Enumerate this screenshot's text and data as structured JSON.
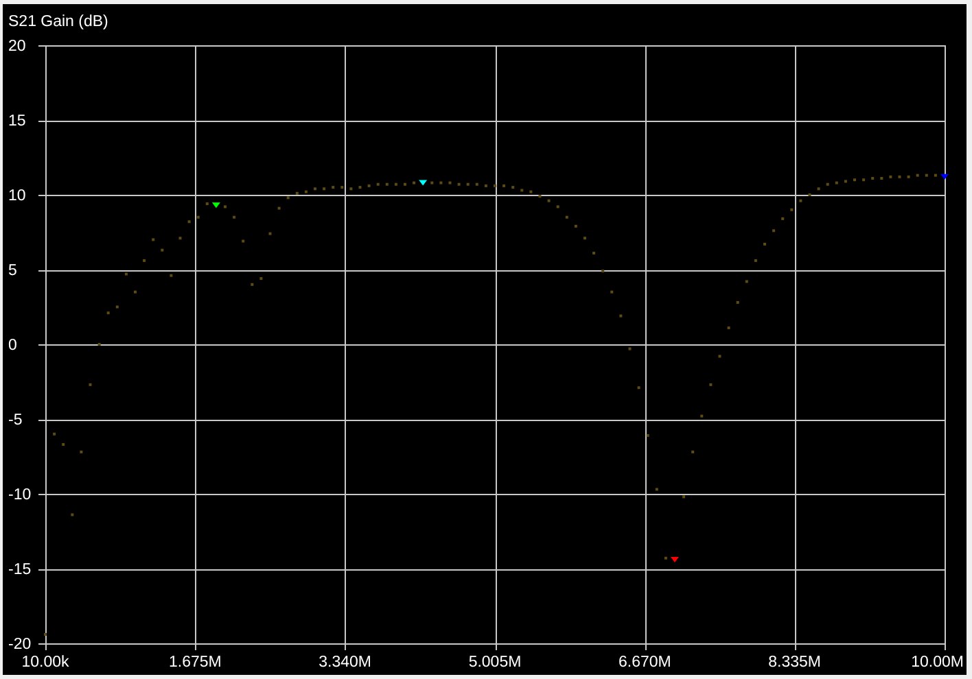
{
  "chart_data": {
    "type": "scatter",
    "title": "S21 Gain (dB)",
    "xlim": [
      10000,
      10000000
    ],
    "ylim": [
      -20,
      20
    ],
    "grid": true,
    "xticks": [
      {
        "value": 10000,
        "label": "10.00k"
      },
      {
        "value": 1675000,
        "label": "1.675M"
      },
      {
        "value": 3340000,
        "label": "3.340M"
      },
      {
        "value": 5005000,
        "label": "5.005M"
      },
      {
        "value": 6670000,
        "label": "6.670M"
      },
      {
        "value": 8335000,
        "label": "8.335M"
      },
      {
        "value": 10000000,
        "label": "10.00M"
      }
    ],
    "yticks": [
      20,
      15,
      10,
      5,
      0,
      -5,
      -10,
      -15,
      -20
    ],
    "x": [
      10000,
      109900,
      209800,
      309700,
      409600,
      509500,
      609400,
      709300,
      809200,
      909100,
      1009000,
      1108900,
      1208800,
      1308700,
      1408600,
      1508500,
      1608400,
      1708300,
      1808200,
      1908100,
      2008000,
      2107900,
      2207800,
      2307700,
      2407600,
      2507500,
      2607400,
      2707300,
      2807200,
      2907100,
      3007000,
      3106900,
      3206800,
      3306700,
      3406600,
      3506500,
      3606400,
      3706300,
      3806200,
      3906100,
      4006000,
      4105900,
      4205800,
      4305700,
      4405600,
      4505500,
      4605400,
      4705300,
      4805200,
      4905100,
      5005000,
      5104900,
      5204800,
      5304700,
      5404600,
      5504500,
      5604400,
      5704300,
      5804200,
      5904100,
      6004000,
      6103900,
      6203800,
      6303700,
      6403600,
      6503500,
      6603400,
      6703300,
      6803200,
      6903100,
      7003000,
      7102900,
      7202800,
      7302700,
      7402600,
      7502500,
      7602400,
      7702300,
      7802200,
      7902100,
      8002000,
      8101900,
      8201800,
      8301700,
      8401600,
      8501500,
      8601400,
      8701300,
      8801200,
      8901100,
      9001000,
      9100900,
      9200800,
      9300700,
      9400600,
      9500500,
      9600400,
      9700300,
      9800200,
      9900100,
      10000000
    ],
    "series": [
      {
        "color": "#5c4b12",
        "values": [
          -19.4,
          -6.0,
          -6.7,
          -11.4,
          -7.2,
          -2.7,
          0.0,
          2.1,
          2.5,
          4.7,
          3.5,
          5.6,
          7.0,
          6.3,
          4.6,
          7.1,
          8.2,
          8.5,
          9.4,
          null,
          9.2,
          8.5,
          6.9,
          4.0,
          4.4,
          7.4,
          9.1,
          9.8,
          10.1,
          10.2,
          10.4,
          10.4,
          10.5,
          10.5,
          10.4,
          10.5,
          10.6,
          10.7,
          10.7,
          10.7,
          10.7,
          10.8,
          null,
          10.8,
          10.8,
          10.8,
          10.7,
          10.7,
          10.7,
          10.6,
          10.6,
          10.6,
          10.5,
          10.3,
          10.2,
          9.9,
          9.6,
          9.2,
          8.5,
          7.9,
          7.1,
          6.1,
          4.9,
          3.5,
          1.9,
          -0.3,
          -2.9,
          -6.1,
          -9.7,
          -14.3,
          null,
          -10.2,
          -7.2,
          -4.8,
          -2.7,
          -0.8,
          1.1,
          2.8,
          4.2,
          5.6,
          6.7,
          7.6,
          8.4,
          9.0,
          9.6,
          10.0,
          10.4,
          10.7,
          10.8,
          10.9,
          11.0,
          11.0,
          11.1,
          11.1,
          11.2,
          11.2,
          11.2,
          11.3,
          11.3,
          11.3,
          null
        ]
      },
      {
        "color": "#00ff00",
        "values": [
          null,
          null,
          null,
          null,
          null,
          null,
          null,
          null,
          null,
          null,
          null,
          null,
          null,
          null,
          null,
          null,
          null,
          null,
          null,
          9.3,
          null,
          null,
          null,
          null,
          null,
          null,
          null,
          null,
          null,
          null,
          null,
          null,
          null,
          null,
          null,
          null,
          null,
          null,
          null,
          null,
          null,
          null,
          null,
          null,
          null,
          null,
          null,
          null,
          null,
          null,
          null,
          null,
          null,
          null,
          null,
          null,
          null,
          null,
          null,
          null,
          null,
          null,
          null,
          null,
          null,
          null,
          null,
          null,
          null,
          null,
          null,
          null,
          null,
          null,
          null,
          null,
          null,
          null,
          null,
          null,
          null,
          null,
          null,
          null,
          null,
          null,
          null,
          null,
          null,
          null,
          null,
          null,
          null,
          null,
          null,
          null,
          null,
          null,
          null,
          null,
          null
        ]
      },
      {
        "color": "#00ffff",
        "values": [
          null,
          null,
          null,
          null,
          null,
          null,
          null,
          null,
          null,
          null,
          null,
          null,
          null,
          null,
          null,
          null,
          null,
          null,
          null,
          null,
          null,
          null,
          null,
          null,
          null,
          null,
          null,
          null,
          null,
          null,
          null,
          null,
          null,
          null,
          null,
          null,
          null,
          null,
          null,
          null,
          null,
          null,
          10.8,
          null,
          null,
          null,
          null,
          null,
          null,
          null,
          null,
          null,
          null,
          null,
          null,
          null,
          null,
          null,
          null,
          null,
          null,
          null,
          null,
          null,
          null,
          null,
          null,
          null,
          null,
          null,
          null,
          null,
          null,
          null,
          null,
          null,
          null,
          null,
          null,
          null,
          null,
          null,
          null,
          null,
          null,
          null,
          null,
          null,
          null,
          null,
          null,
          null,
          null,
          null,
          null,
          null,
          null,
          null,
          null,
          null,
          null
        ]
      },
      {
        "color": "#ff0000",
        "values": [
          null,
          null,
          null,
          null,
          null,
          null,
          null,
          null,
          null,
          null,
          null,
          null,
          null,
          null,
          null,
          null,
          null,
          null,
          null,
          null,
          null,
          null,
          null,
          null,
          null,
          null,
          null,
          null,
          null,
          null,
          null,
          null,
          null,
          null,
          null,
          null,
          null,
          null,
          null,
          null,
          null,
          null,
          null,
          null,
          null,
          null,
          null,
          null,
          null,
          null,
          null,
          null,
          null,
          null,
          null,
          null,
          null,
          null,
          null,
          null,
          null,
          null,
          null,
          null,
          null,
          null,
          null,
          null,
          null,
          null,
          -14.4,
          null,
          null,
          null,
          null,
          null,
          null,
          null,
          null,
          null,
          null,
          null,
          null,
          null,
          null,
          null,
          null,
          null,
          null,
          null,
          null,
          null,
          null,
          null,
          null,
          null,
          null,
          null,
          null,
          null,
          null
        ]
      },
      {
        "color": "#0000ff",
        "values": [
          null,
          null,
          null,
          null,
          null,
          null,
          null,
          null,
          null,
          null,
          null,
          null,
          null,
          null,
          null,
          null,
          null,
          null,
          null,
          null,
          null,
          null,
          null,
          null,
          null,
          null,
          null,
          null,
          null,
          null,
          null,
          null,
          null,
          null,
          null,
          null,
          null,
          null,
          null,
          null,
          null,
          null,
          null,
          null,
          null,
          null,
          null,
          null,
          null,
          null,
          null,
          null,
          null,
          null,
          null,
          null,
          null,
          null,
          null,
          null,
          null,
          null,
          null,
          null,
          null,
          null,
          null,
          null,
          null,
          null,
          null,
          null,
          null,
          null,
          null,
          null,
          null,
          null,
          null,
          null,
          null,
          null,
          null,
          null,
          null,
          null,
          null,
          null,
          null,
          null,
          null,
          null,
          null,
          null,
          null,
          null,
          null,
          null,
          null,
          null,
          11.2
        ]
      }
    ]
  }
}
